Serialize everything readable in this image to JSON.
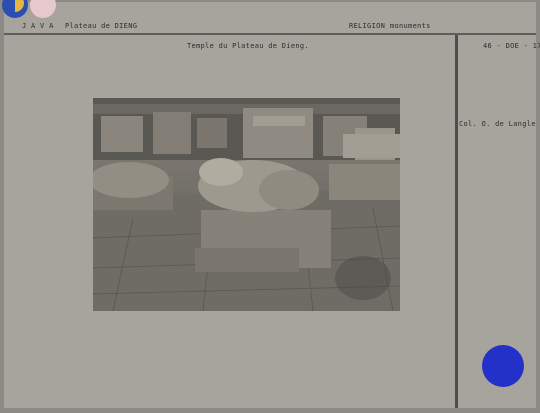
{
  "header": {
    "location": "J A V A",
    "site": "Plateau de DIENG",
    "category": "RELIGION",
    "subcategory": "monuments"
  },
  "main": {
    "title": "Temple du Plateau de Dieng."
  },
  "side": {
    "reference": "46 - DOE - 17",
    "credit": "Col. O. de Langle"
  },
  "colors": {
    "card": "#a7a49d",
    "dot": "#2431c8"
  }
}
